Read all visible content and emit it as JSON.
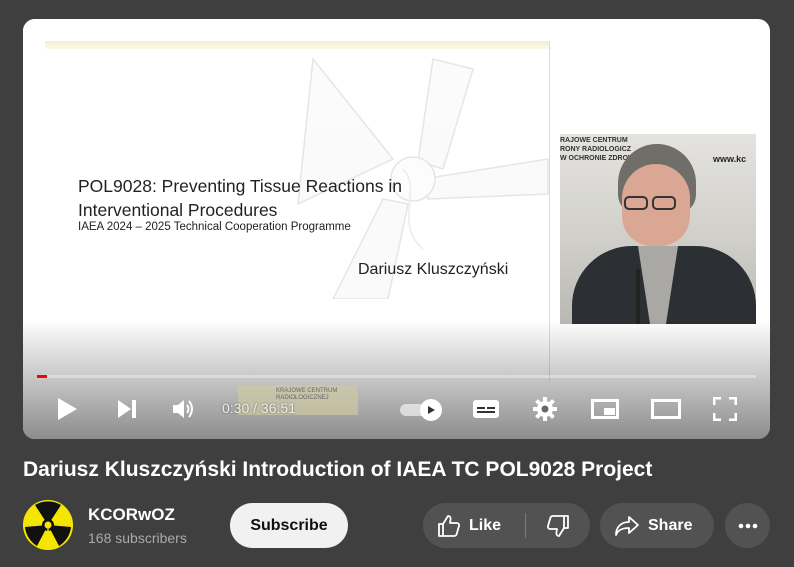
{
  "video": {
    "slide": {
      "title": "POL9028: Preventing Tissue Reactions in Interventional Procedures",
      "subtitle": "IAEA 2024 – 2025 Technical Cooperation Programme",
      "author": "Dariusz Kluszczyński"
    },
    "camera": {
      "website": "www.kc",
      "org_text": "RAJOWE CENTRUM\nRONY RADIOLOGICZ\nW OCHRONIE ZDROWI"
    },
    "thumbnail_text": "KRAJOWE CENTRUM\nRADIOLOGICZNEJ"
  },
  "player": {
    "current_time": "0:30",
    "duration": "36:51",
    "time_display": "0:30 / 36:51",
    "progress_fraction": 0.0136,
    "accent_color": "#ff0000",
    "controls": [
      "play-icon",
      "next-icon",
      "volume-icon",
      "autoplay-toggle",
      "subtitles-icon",
      "settings-icon",
      "miniplayer-icon",
      "theater-icon",
      "fullscreen-icon"
    ]
  },
  "title": "Dariusz Kluszczyński Introduction of IAEA TC POL9028 Project",
  "channel": {
    "name": "KCORwOZ",
    "subscribers": "168 subscribers"
  },
  "actions": {
    "subscribe_label": "Subscribe",
    "like_label": "Like",
    "share_label": "Share"
  }
}
